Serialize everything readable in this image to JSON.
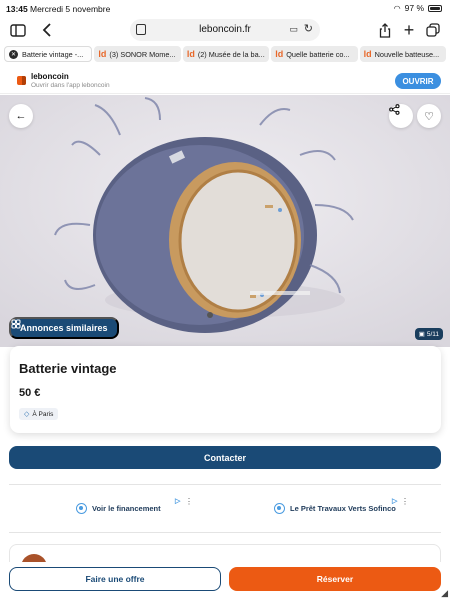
{
  "status_bar": {
    "time": "13:45",
    "date": "Mercredi 5 novembre",
    "battery": "97 %"
  },
  "browser": {
    "url": "leboncoin.fr"
  },
  "tabs": [
    {
      "label": "Batterie vintage -...",
      "favicon": "",
      "active": true
    },
    {
      "label": "(3) SONOR Mome...",
      "favicon": "ld",
      "active": false
    },
    {
      "label": "(2) Musée de la ba...",
      "favicon": "ld",
      "active": false
    },
    {
      "label": "Quelle batterie co...",
      "favicon": "ld",
      "active": false
    },
    {
      "label": "Nouvelle batteuse...",
      "favicon": "ld",
      "active": false
    }
  ],
  "app_banner": {
    "name": "leboncoin",
    "subtitle": "Ouvrir dans l'app leboncoin",
    "open_label": "OUVRIR"
  },
  "photo": {
    "similar_label": "Annonces similaires",
    "counter": "5/11"
  },
  "listing": {
    "title": "Batterie vintage",
    "price": "50 €",
    "location": "À Paris"
  },
  "actions": {
    "contact_label": "Contacter",
    "offer_label": "Faire une offre",
    "reserve_label": "Réserver"
  },
  "ads": [
    {
      "label": "Voir le financement"
    },
    {
      "label": "Le Prêt Travaux Verts Sofinco"
    }
  ],
  "colors": {
    "brand_orange": "#ec5a13",
    "primary_blue": "#1a4a76",
    "app_open_blue": "#3b8fe0"
  }
}
